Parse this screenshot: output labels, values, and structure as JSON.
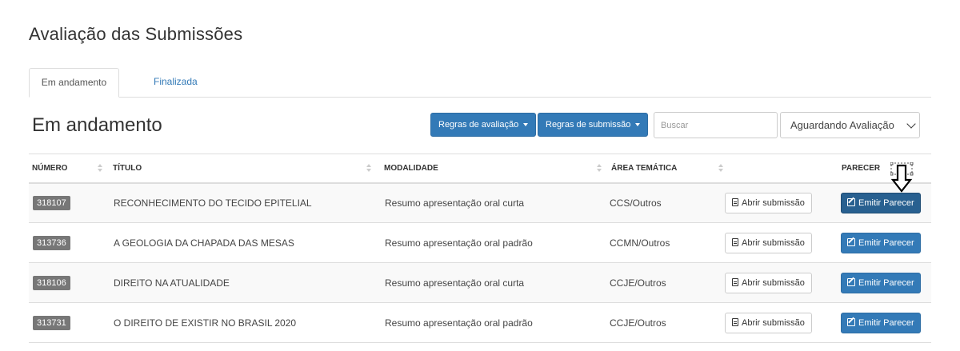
{
  "page": {
    "title": "Avaliação das Submissões"
  },
  "tabs": [
    {
      "label": "Em andamento",
      "active": true
    },
    {
      "label": "Finalizada",
      "active": false
    }
  ],
  "section": {
    "title": "Em andamento"
  },
  "toolbar": {
    "rules_eval_label": "Regras de avaliação",
    "rules_sub_label": "Regras de submissão",
    "search_placeholder": "Buscar",
    "status_selected": "Aguardando Avaliação"
  },
  "table": {
    "headers": {
      "numero": "NÚMERO",
      "titulo": "TÍTULO",
      "modalidade": "MODALIDADE",
      "area": "ÁREA TEMÁTICA",
      "parecer": "PARECER"
    },
    "open_label": "Abrir submissão",
    "emit_label": "Emitir Parecer",
    "rows": [
      {
        "numero": "318107",
        "titulo": "RECONHECIMENTO DO TECIDO EPITELIAL",
        "modalidade": "Resumo apresentação oral curta",
        "area": "CCS/Outros"
      },
      {
        "numero": "313736",
        "titulo": "A GEOLOGIA DA CHAPADA DAS MESAS",
        "modalidade": "Resumo apresentação oral padrão",
        "area": "CCMN/Outros"
      },
      {
        "numero": "318106",
        "titulo": "DIREITO NA ATUALIDADE",
        "modalidade": "Resumo apresentação oral curta",
        "area": "CCJE/Outros"
      },
      {
        "numero": "313731",
        "titulo": "O DIREITO DE EXISTIR NO BRASIL 2020",
        "modalidade": "Resumo apresentação oral padrão",
        "area": "CCJE/Outros"
      }
    ]
  },
  "colors": {
    "primary": "#337ab7",
    "primary_dark": "#286090",
    "badge": "#777777"
  },
  "icons": {
    "open": "file-text-icon",
    "emit": "edit-icon",
    "cursor": "arrow-down-cursor-icon"
  }
}
